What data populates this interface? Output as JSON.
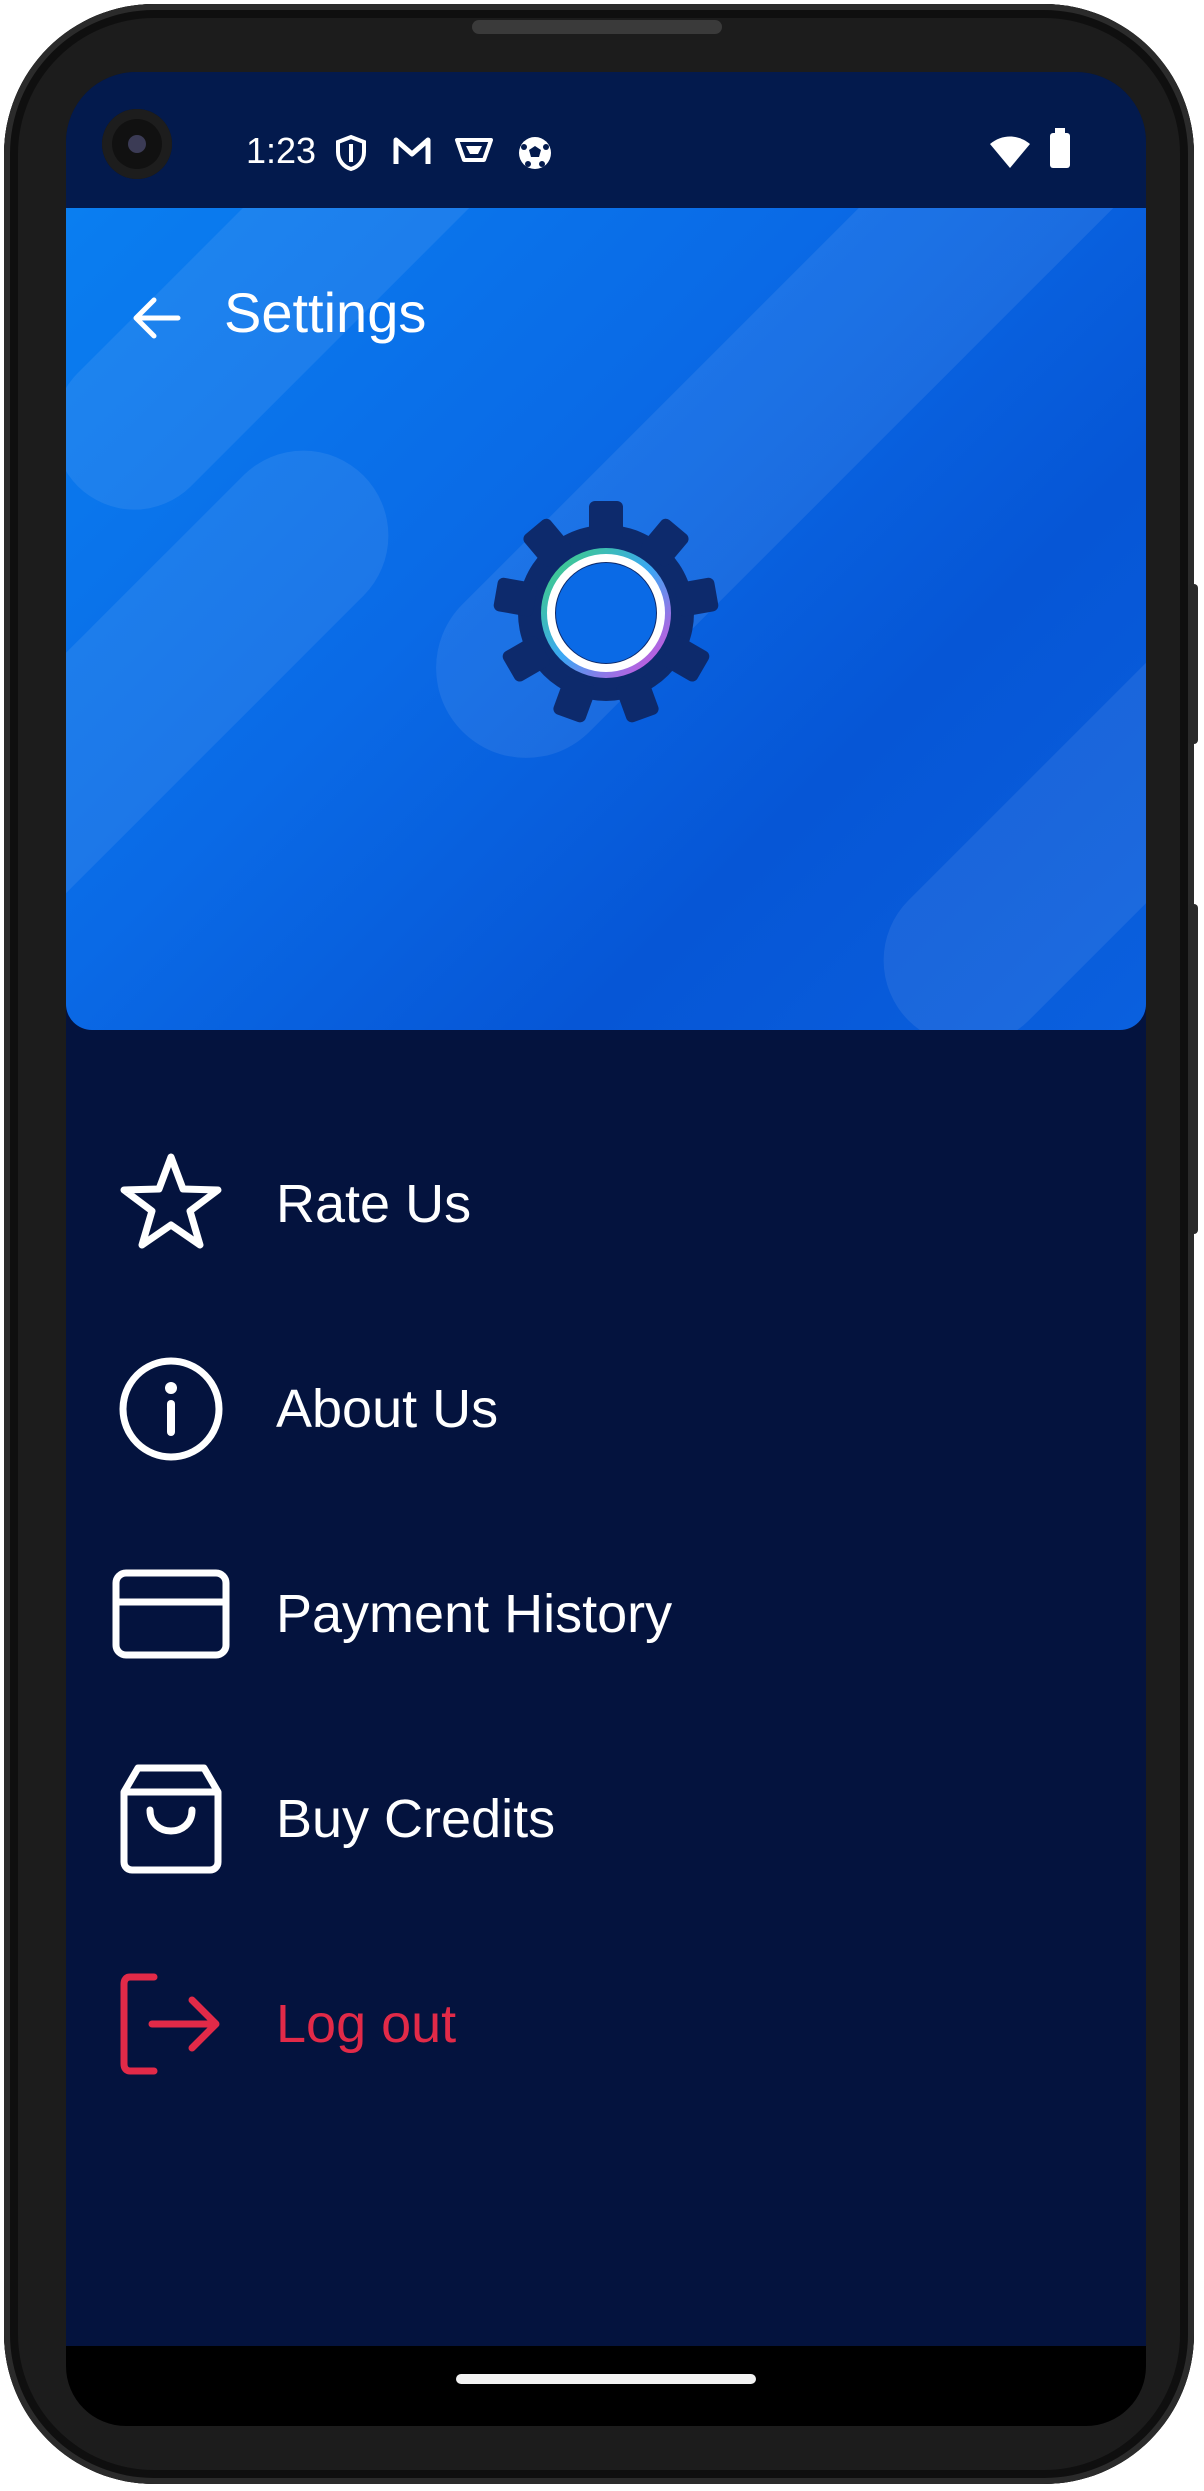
{
  "status_bar": {
    "time": "1:23",
    "notification_icons": [
      "shield-icon",
      "gmail-icon",
      "bowl-icon",
      "soccer-ball-icon"
    ],
    "system_icons": [
      "wifi-icon",
      "battery-icon"
    ]
  },
  "header": {
    "title": "Settings",
    "hero_icon": "gear-icon",
    "background_color": "#0a6ae6"
  },
  "menu": {
    "items": [
      {
        "label": "Rate Us",
        "icon": "star-icon"
      },
      {
        "label": "About Us",
        "icon": "info-icon"
      },
      {
        "label": "Payment History",
        "icon": "credit-card-icon"
      },
      {
        "label": "Buy Credits",
        "icon": "shopping-bag-icon"
      },
      {
        "label": "Log out",
        "icon": "logout-icon",
        "color": "#e22a48"
      }
    ]
  },
  "colors": {
    "background": "#04133e",
    "accent": "#0a6ae6",
    "logout": "#e22a48",
    "text": "#ffffff"
  }
}
